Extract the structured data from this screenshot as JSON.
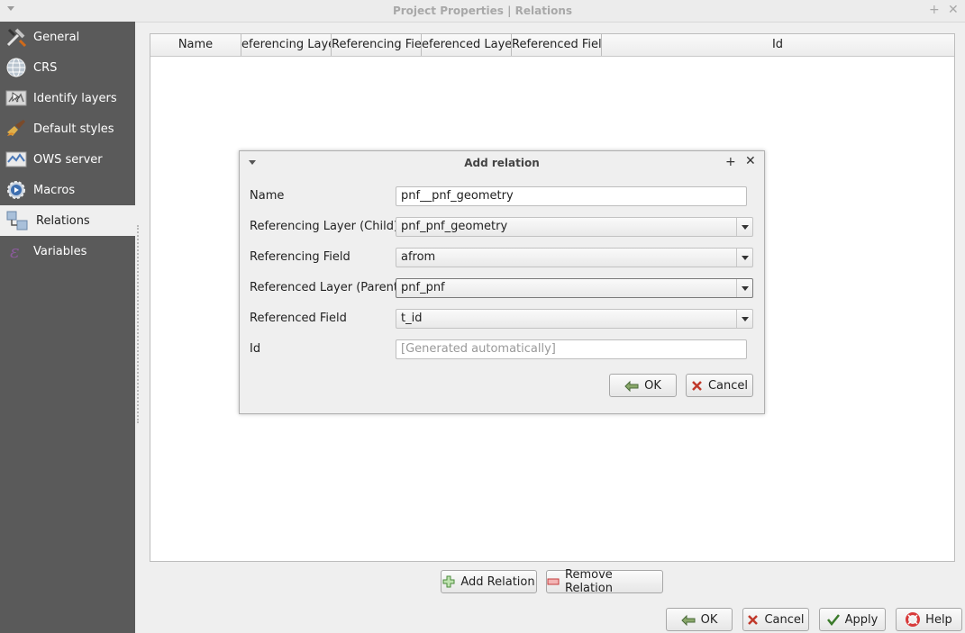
{
  "window": {
    "title": "Project Properties | Relations"
  },
  "sidebar": {
    "items": [
      {
        "label": "General",
        "icon": "tools-icon"
      },
      {
        "label": "CRS",
        "icon": "globe-icon"
      },
      {
        "label": "Identify layers",
        "icon": "identify-icon"
      },
      {
        "label": "Default styles",
        "icon": "brush-icon"
      },
      {
        "label": "OWS server",
        "icon": "map-server-icon"
      },
      {
        "label": "Macros",
        "icon": "gear-play-icon"
      },
      {
        "label": "Relations",
        "icon": "relations-icon",
        "selected": true
      },
      {
        "label": "Variables",
        "icon": "epsilon-icon"
      }
    ]
  },
  "table": {
    "columns": [
      "Name",
      "eferencing Laye",
      "Referencing Field",
      "eferenced Laye",
      "Referenced Field",
      "Id"
    ]
  },
  "relation_buttons": {
    "add": "Add Relation",
    "remove": "Remove Relation"
  },
  "dialog": {
    "title": "Add relation",
    "fields": {
      "name_label": "Name",
      "name_value": "pnf__pnf_geometry",
      "ref_layer_label": "Referencing Layer (Child)",
      "ref_layer_value": "pnf_pnf_geometry",
      "ref_field_label": "Referencing Field",
      "ref_field_value": "afrom",
      "refd_layer_label": "Referenced Layer (Parent)",
      "refd_layer_value": "pnf_pnf",
      "refd_field_label": "Referenced Field",
      "refd_field_value": "t_id",
      "id_label": "Id",
      "id_placeholder": "[Generated automatically]"
    },
    "ok": "OK",
    "cancel": "Cancel"
  },
  "footer": {
    "ok": "OK",
    "cancel": "Cancel",
    "apply": "Apply",
    "help": "Help"
  }
}
